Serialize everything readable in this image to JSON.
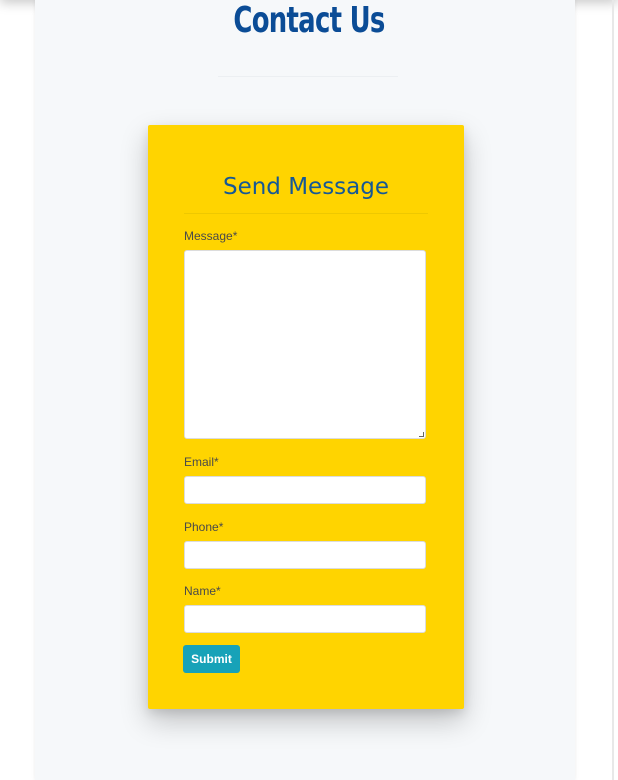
{
  "page": {
    "title": "Contact Us",
    "title_color": "#0b4c96",
    "background": "#f6f8fa"
  },
  "form": {
    "title": "Send Message",
    "card_color": "#ffd400",
    "title_color": "#155896",
    "fields": [
      {
        "label": "Message*",
        "type": "textarea",
        "value": ""
      },
      {
        "label": "Email*",
        "type": "text",
        "value": ""
      },
      {
        "label": "Phone*",
        "type": "text",
        "value": ""
      },
      {
        "label": "Name*",
        "type": "text",
        "value": ""
      }
    ],
    "submit_label": "Submit",
    "submit_color": "#17a2b8"
  }
}
